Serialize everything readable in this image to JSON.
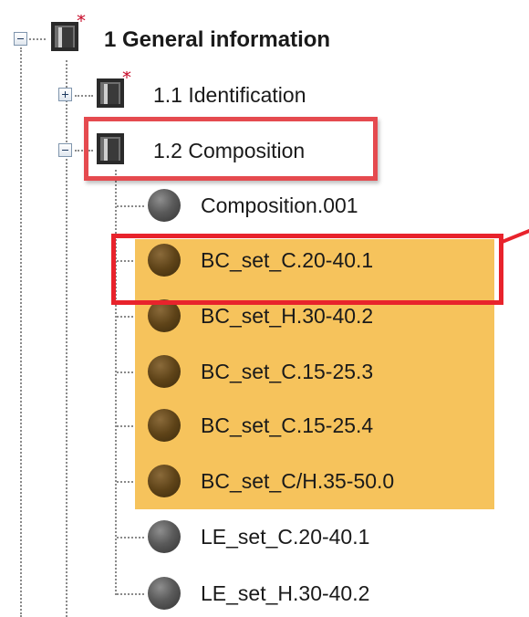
{
  "tree": {
    "root": {
      "label": "1 General information",
      "icon": "folder-required-icon",
      "expanded": true
    },
    "sections": [
      {
        "label": "1.1 Identification",
        "icon": "folder-required-icon",
        "expanded": false
      },
      {
        "label": "1.2 Composition",
        "icon": "folder-icon",
        "expanded": true
      }
    ],
    "records": [
      {
        "label": "Composition.001",
        "icon": "gray-record-icon",
        "highlighted": false
      },
      {
        "label": "BC_set_C.20-40.1",
        "icon": "brown-record-icon",
        "highlighted": true
      },
      {
        "label": "BC_set_H.30-40.2",
        "icon": "brown-record-icon",
        "highlighted": true
      },
      {
        "label": "BC_set_C.15-25.3",
        "icon": "brown-record-icon",
        "highlighted": true
      },
      {
        "label": "BC_set_C.15-25.4",
        "icon": "brown-record-icon",
        "highlighted": true
      },
      {
        "label": "BC_set_C/H.35-50.0",
        "icon": "brown-record-icon",
        "highlighted": true
      },
      {
        "label": "LE_set_C.20-40.1",
        "icon": "gray-record-icon",
        "highlighted": false
      },
      {
        "label": "LE_set_H.30-40.2",
        "icon": "gray-record-icon",
        "highlighted": false
      }
    ]
  },
  "colors": {
    "highlight": "#f6c35c",
    "annotation_red": "#e8232c",
    "required_star": "#c8102e"
  }
}
